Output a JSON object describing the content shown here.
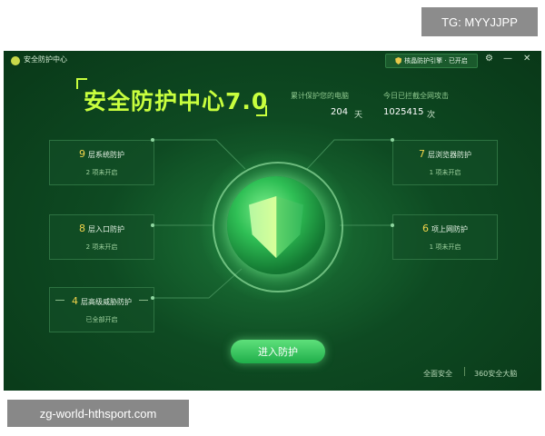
{
  "watermark_tag": "TG: MYYJJPP",
  "source_caption": "zg-world-hthsport.com",
  "window": {
    "app_title": "安全防护中心",
    "engine_status": "核晶防护引擎 · 已开启",
    "settings_glyph": "⚙",
    "minimize_glyph": "—",
    "close_glyph": "✕"
  },
  "headline": "安全防护中心7.0",
  "stats": {
    "protected_label": "累计保护您的电脑",
    "protected_value": "204",
    "protected_unit": "天",
    "blocked_label": "今日已拦截全网攻击",
    "blocked_value": "1025415",
    "blocked_unit": "次"
  },
  "cards": [
    {
      "num": "9",
      "title": "层系统防护",
      "sub": "2 项未开启"
    },
    {
      "num": "8",
      "title": "层入口防护",
      "sub": "2 项未开启"
    },
    {
      "num": "4",
      "title": "层高级威胁防护",
      "sub": "已全部开启"
    },
    {
      "num": "7",
      "title": "层浏览器防护",
      "sub": "1 项未开启"
    },
    {
      "num": "6",
      "title": "项上网防护",
      "sub": "1 项未开启"
    }
  ],
  "enter_button": "进入防护",
  "footer": {
    "full_security": "全面安全",
    "brain": "360安全大脑"
  },
  "colors": {
    "accent": "#c8ff3e",
    "window_bg": "#0e4a22",
    "button": "#1fae4a",
    "card_number": "#f2d44b"
  }
}
